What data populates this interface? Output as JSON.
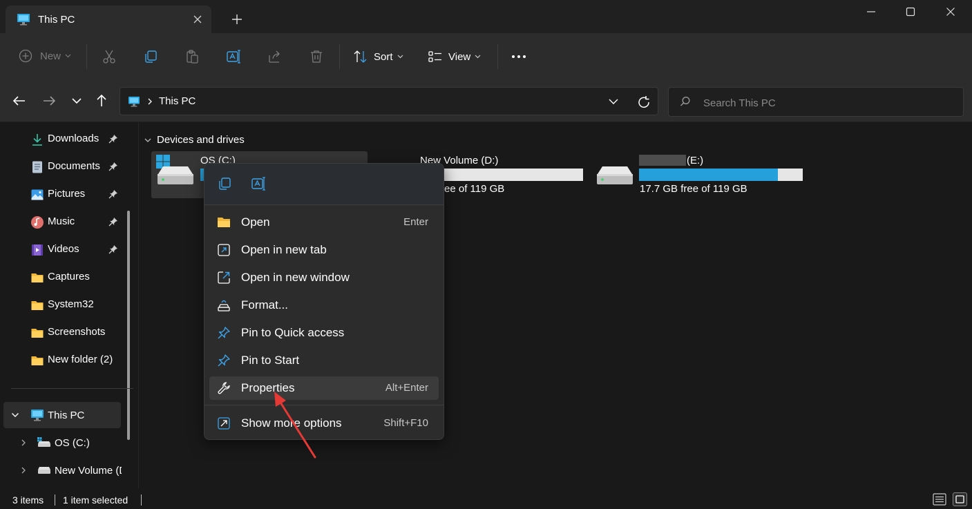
{
  "window": {
    "tab_title": "This PC",
    "accent": "#26a0da"
  },
  "toolbar": {
    "new_label": "New",
    "sort_label": "Sort",
    "view_label": "View",
    "icons": [
      "cut-icon",
      "copy-icon",
      "paste-icon",
      "rename-icon",
      "share-icon",
      "delete-icon",
      "more-icon"
    ]
  },
  "address": {
    "path": "This PC"
  },
  "search": {
    "placeholder": "Search This PC"
  },
  "sidebar": {
    "quick_access": [
      {
        "label": "Downloads",
        "pinned": true,
        "icon": "download-icon"
      },
      {
        "label": "Documents",
        "pinned": true,
        "icon": "document-icon"
      },
      {
        "label": "Pictures",
        "pinned": true,
        "icon": "pictures-icon"
      },
      {
        "label": "Music",
        "pinned": true,
        "icon": "music-icon"
      },
      {
        "label": "Videos",
        "pinned": true,
        "icon": "videos-icon"
      },
      {
        "label": "Captures",
        "pinned": false,
        "icon": "folder-icon"
      },
      {
        "label": "System32",
        "pinned": false,
        "icon": "folder-icon"
      },
      {
        "label": "Screenshots",
        "pinned": false,
        "icon": "folder-icon"
      },
      {
        "label": "New folder (2)",
        "pinned": false,
        "icon": "folder-icon"
      }
    ],
    "this_pc": "This PC",
    "drives": [
      "OS (C:)",
      "New Volume (D:)"
    ]
  },
  "content": {
    "section_title": "Devices and drives",
    "drives": [
      {
        "name": "OS (C:)",
        "free_text": "",
        "used_fraction": 0.55
      },
      {
        "name": "New Volume (D:)",
        "free_text": "GB free of 119 GB",
        "used_fraction": 0.0
      },
      {
        "name": "(E:)",
        "free_text": "17.7 GB free of 119 GB",
        "used_fraction": 0.85
      }
    ]
  },
  "context_menu": {
    "top_icons": [
      "copy-icon",
      "rename-icon"
    ],
    "items": [
      {
        "label": "Open",
        "shortcut": "Enter",
        "icon": "folder-open-icon"
      },
      {
        "label": "Open in new tab",
        "shortcut": "",
        "icon": "new-tab-icon"
      },
      {
        "label": "Open in new window",
        "shortcut": "",
        "icon": "new-window-icon"
      },
      {
        "label": "Format...",
        "shortcut": "",
        "icon": "format-icon"
      },
      {
        "label": "Pin to Quick access",
        "shortcut": "",
        "icon": "pin-icon"
      },
      {
        "label": "Pin to Start",
        "shortcut": "",
        "icon": "pin-icon"
      },
      {
        "label": "Properties",
        "shortcut": "Alt+Enter",
        "icon": "wrench-icon",
        "hovered": true
      },
      {
        "label": "Show more options",
        "shortcut": "Shift+F10",
        "icon": "more-options-icon"
      }
    ]
  },
  "status": {
    "items_count": "3 items",
    "selection": "1 item selected"
  }
}
